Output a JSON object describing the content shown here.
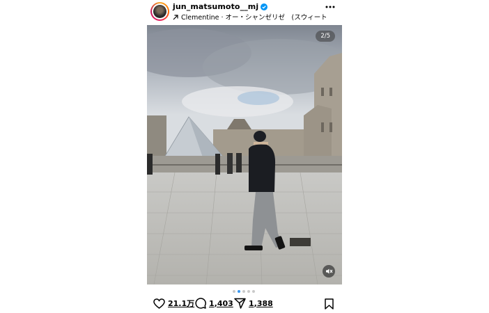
{
  "post": {
    "username": "jun_matsumoto__mj",
    "audio": "Clementine · オー・シャンゼリゼ　(スウィート・…",
    "counter": "2/5",
    "likes": "21.1万",
    "comments": "1,403",
    "shares": "1,388",
    "carousel": {
      "total": 5,
      "current": 2
    }
  },
  "icons": {
    "verified": "verified-badge-icon",
    "audio": "arrow-up-right-icon",
    "more": "more-icon",
    "mute": "mute-icon",
    "like": "heart-icon",
    "comment": "comment-icon",
    "share": "send-icon",
    "save": "bookmark-icon"
  },
  "colors": {
    "verified": "#0095f6",
    "active_dot": "#3897f0"
  }
}
